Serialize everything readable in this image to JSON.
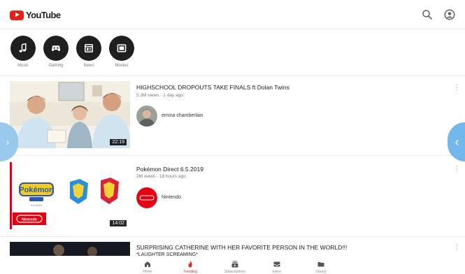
{
  "app": {
    "logo_text": "YouTube",
    "brand_color": "#e62117"
  },
  "header": {
    "search_icon": "search-icon",
    "account_icon": "account-icon"
  },
  "categories": [
    {
      "label": "Music",
      "icon": "music-note-icon"
    },
    {
      "label": "Gaming",
      "icon": "gamepad-icon"
    },
    {
      "label": "News",
      "icon": "newspaper-icon"
    },
    {
      "label": "Movies",
      "icon": "film-icon"
    }
  ],
  "videos": [
    {
      "title": "HIGHSCHOOL DROPOUTS TAKE FINALS ft Dolan Twins",
      "meta": "5.3M views · 1 day ago",
      "channel": "emma chamberlain",
      "duration": "22:19"
    },
    {
      "title": "Pokémon Direct 6.5.2019",
      "meta": "2M views · 18 hours ago",
      "channel": "Nintendo",
      "duration": "14:02",
      "thumb_text": {
        "pokemon": "Pokémon",
        "badge": "Nintendo",
        "date": "6.5.2019"
      }
    },
    {
      "title": "SURPRISING CATHERINE WITH HER FAVORITE PERSON IN THE WORLD!!!",
      "subtitle": "*LAUGHTER SCREAMING*",
      "meta": "",
      "channel": "",
      "duration": ""
    }
  ],
  "bottom_nav": [
    {
      "label": "Home",
      "icon": "home-icon",
      "active": false
    },
    {
      "label": "Trending",
      "icon": "trending-flame-icon",
      "active": true
    },
    {
      "label": "Subscriptions",
      "icon": "subscriptions-icon",
      "active": false
    },
    {
      "label": "Inbox",
      "icon": "inbox-icon",
      "active": false
    },
    {
      "label": "Library",
      "icon": "library-folder-icon",
      "active": false
    }
  ]
}
